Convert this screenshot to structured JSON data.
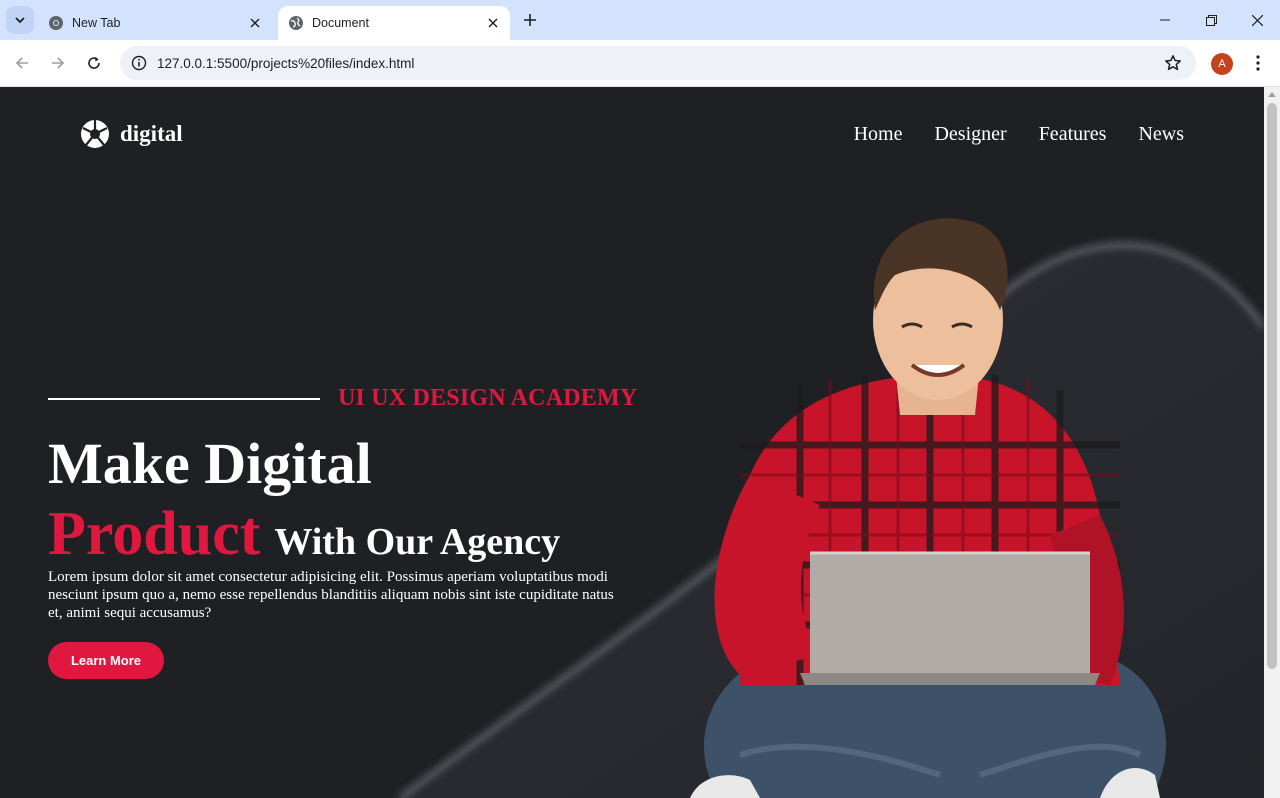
{
  "browser": {
    "tabs": [
      {
        "title": "New Tab",
        "active": false
      },
      {
        "title": "Document",
        "active": true
      }
    ],
    "url": "127.0.0.1:5500/projects%20files/index.html",
    "profile_initial": "A"
  },
  "site": {
    "brand": "digital",
    "nav": [
      "Home",
      "Designer",
      "Features",
      "News"
    ],
    "kicker": "UI UX DESIGN ACADEMY",
    "headline_line1": "Make Digital",
    "headline_highlight": "Product",
    "headline_rest": "With Our Agency",
    "paragraph": "Lorem ipsum dolor sit amet consectetur adipisicing elit. Possimus aperiam voluptatibus modi nesciunt ipsum quo a, nemo esse repellendus blanditiis aliquam nobis sint iste cupiditate natus et, animi sequi accusamus?",
    "cta_label": "Learn More"
  },
  "colors": {
    "accent": "#e0173f",
    "page_bg": "#1f2024",
    "tabstrip_bg": "#d3e3fd"
  },
  "icons": {
    "tab_menu": "chevron-down-icon",
    "newtab_favicon": "chrome-icon",
    "document_favicon": "globe-icon",
    "site_info": "info-icon",
    "bookmark": "star-icon",
    "brand_logo": "aperture-icon"
  }
}
